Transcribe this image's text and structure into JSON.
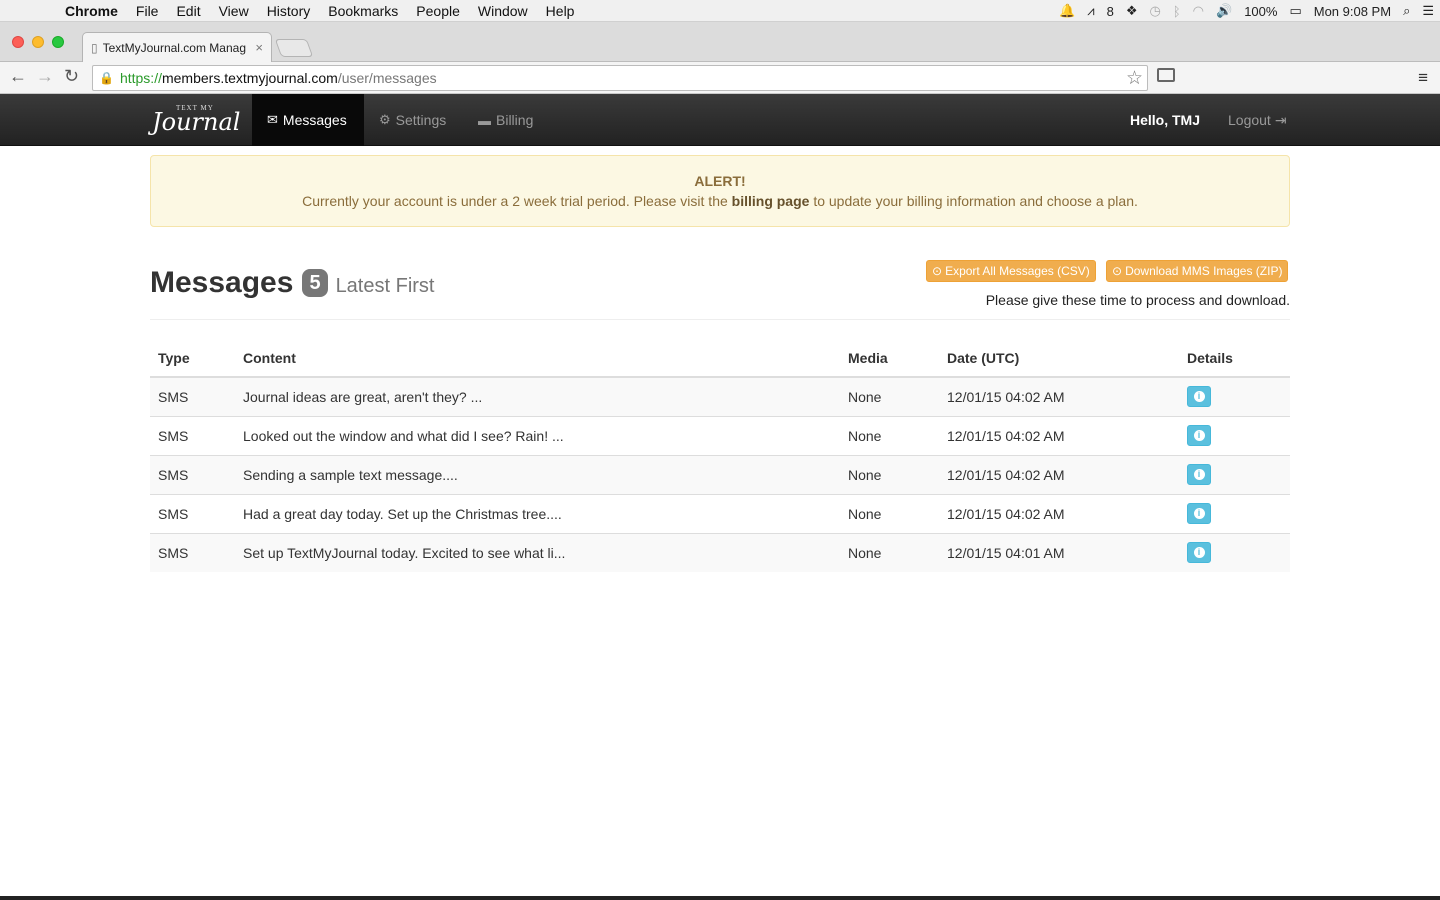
{
  "menubar": {
    "app": "Chrome",
    "items": [
      "File",
      "Edit",
      "View",
      "History",
      "Bookmarks",
      "People",
      "Window",
      "Help"
    ],
    "notifications_count": "8",
    "battery": "100%",
    "clock": "Mon 9:08 PM"
  },
  "browser": {
    "tab_title": "TextMyJournal.com Manag",
    "url_scheme": "https://",
    "url_host": "members.textmyjournal.com",
    "url_path": "/user/messages"
  },
  "nav": {
    "brand_small": "TEXT MY",
    "brand_script": "Journal",
    "messages": "Messages",
    "settings": "Settings",
    "billing": "Billing",
    "hello": "Hello, TMJ",
    "logout": "Logout"
  },
  "alert": {
    "heading": "ALERT!",
    "text_before": "Currently your account is under a 2 week trial period. Please visit the ",
    "link": "billing page",
    "text_after": " to update your billing information and choose a plan."
  },
  "header": {
    "title": "Messages",
    "count": "5",
    "subtitle": "Latest First",
    "export_button": "Export All Messages (CSV)",
    "download_button": "Download MMS Images (ZIP)",
    "note": "Please give these time to process and download."
  },
  "table": {
    "columns": [
      "Type",
      "Content",
      "Media",
      "Date (UTC)",
      "Details"
    ],
    "rows": [
      {
        "type": "SMS",
        "content": "Journal ideas are great, aren't they? ...",
        "media": "None",
        "date": "12/01/15 04:02 AM"
      },
      {
        "type": "SMS",
        "content": "Looked out the window and what did I see? Rain! ...",
        "media": "None",
        "date": "12/01/15 04:02 AM"
      },
      {
        "type": "SMS",
        "content": "Sending a sample text message....",
        "media": "None",
        "date": "12/01/15 04:02 AM"
      },
      {
        "type": "SMS",
        "content": "Had a great day today. Set up the Christmas tree....",
        "media": "None",
        "date": "12/01/15 04:02 AM"
      },
      {
        "type": "SMS",
        "content": "Set up TextMyJournal today. Excited to see what li...",
        "media": "None",
        "date": "12/01/15 04:01 AM"
      }
    ]
  },
  "colors": {
    "navbar": "#222222",
    "alert_bg": "#fcf8e3",
    "warning_button": "#f0ad4e",
    "info_button": "#5bc0de"
  }
}
